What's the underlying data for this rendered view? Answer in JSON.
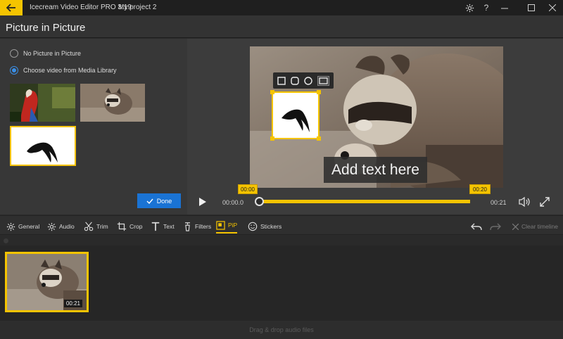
{
  "app": {
    "title": "Icecream Video Editor PRO 3.19",
    "separator": "-",
    "project_name": "My project 2",
    "accent": "#f5c400"
  },
  "titlebar": {
    "back_icon": "arrow-left-icon",
    "settings_icon": "gear-icon",
    "help_label": "?",
    "minimize_icon": "minimize-icon",
    "maximize_icon": "maximize-icon",
    "close_icon": "close-icon"
  },
  "header": {
    "title": "Picture in Picture"
  },
  "pip_options": {
    "options": [
      {
        "label": "No Picture in Picture",
        "selected": false
      },
      {
        "label": "Choose video from Media Library",
        "selected": true
      }
    ],
    "done_label": "Done"
  },
  "preview": {
    "overlay_text": "Add text here",
    "shape_buttons": [
      "square-shape-icon",
      "rounded-shape-icon",
      "circle-shape-icon",
      "rectangle-shape-icon"
    ],
    "marker_start": "00:00",
    "marker_end": "00:20",
    "time_current": "00:00.0",
    "time_total": "00:21",
    "progress_fraction": 0.0
  },
  "tools": [
    {
      "label": "General",
      "icon": "gear-icon",
      "active": false
    },
    {
      "label": "Audio",
      "icon": "audio-settings-icon",
      "active": false
    },
    {
      "label": "Trim",
      "icon": "scissors-icon",
      "active": false
    },
    {
      "label": "Crop",
      "icon": "crop-icon",
      "active": false
    },
    {
      "label": "Text",
      "icon": "text-icon",
      "active": false
    },
    {
      "label": "Filters",
      "icon": "filters-icon",
      "active": false
    },
    {
      "label": "PiP",
      "icon": "pip-icon",
      "active": true
    },
    {
      "label": "Stickers",
      "icon": "smiley-icon",
      "active": false
    }
  ],
  "history": {
    "undo_icon": "undo-icon",
    "redo_icon": "redo-icon",
    "clear_label": "Clear timeline"
  },
  "timeline": {
    "clip_duration": "00:21",
    "audio_placeholder": "Drag & drop audio files"
  }
}
